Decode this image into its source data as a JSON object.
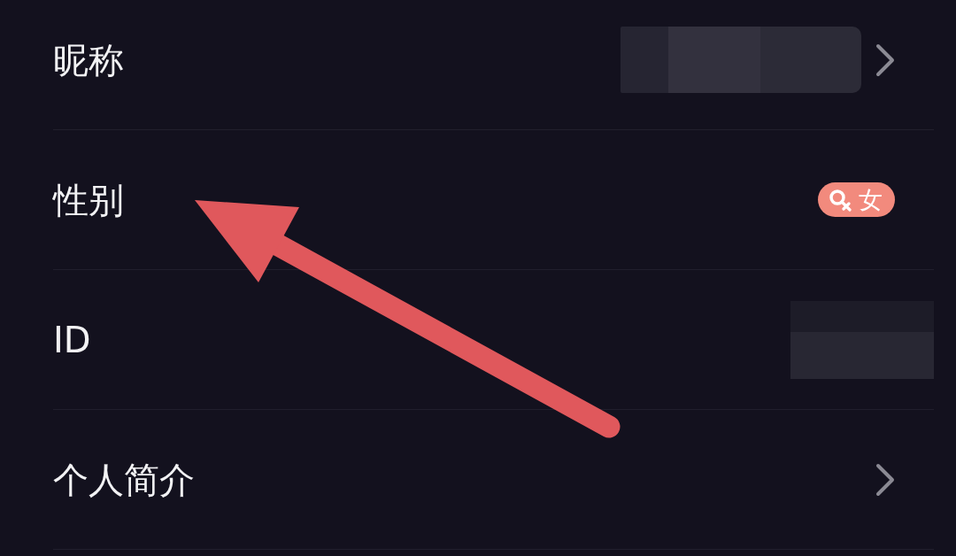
{
  "rows": [
    {
      "label": "昵称",
      "kind": "redacted",
      "chevron": true
    },
    {
      "label": "性别",
      "kind": "gender",
      "badge": "女",
      "chevron": false
    },
    {
      "label": "ID",
      "kind": "redacted",
      "chevron": false
    },
    {
      "label": "个人简介",
      "kind": "plain",
      "chevron": true
    }
  ]
}
